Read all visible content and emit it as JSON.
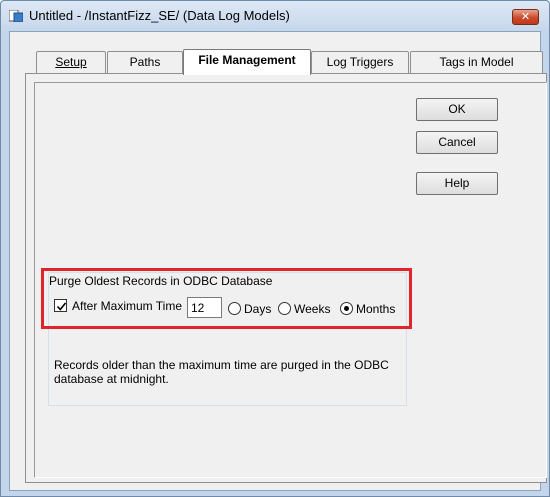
{
  "window": {
    "title": "Untitled - /InstantFizz_SE/ (Data Log Models)",
    "close_label": "✕"
  },
  "tabs": [
    {
      "label": "Setup",
      "active": false
    },
    {
      "label": "Paths",
      "active": false
    },
    {
      "label": "File Management",
      "active": true
    },
    {
      "label": "Log Triggers",
      "active": false
    },
    {
      "label": "Tags in Model",
      "active": false
    }
  ],
  "buttons": {
    "ok": "OK",
    "cancel": "Cancel",
    "help": "Help"
  },
  "purge_group": {
    "title": "Purge Oldest Records in ODBC Database",
    "after_max_time_label": "After Maximum Time",
    "after_max_time_checked": true,
    "max_time_value": "12",
    "units": [
      {
        "label": "Days",
        "selected": false
      },
      {
        "label": "Weeks",
        "selected": false
      },
      {
        "label": "Months",
        "selected": true
      }
    ],
    "description": "Records older than the maximum time are purged in the ODBC database at midnight."
  },
  "colors": {
    "highlight": "#e0242c",
    "title_bar": "#c6d7ec",
    "close_button": "#c94a2a"
  }
}
